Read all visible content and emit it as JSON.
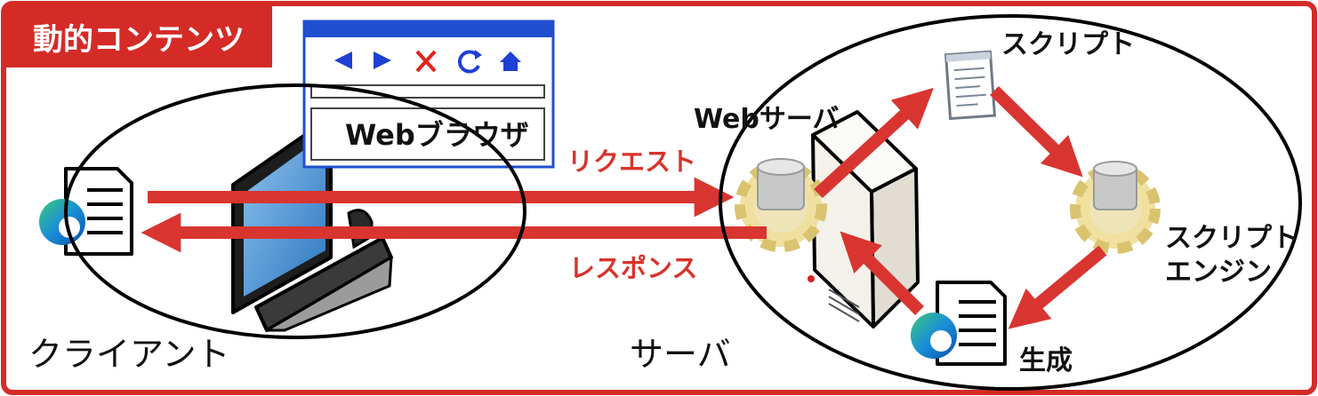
{
  "title": "動的コンテンツ",
  "browser": {
    "label": "Webブラウザ"
  },
  "arrows": {
    "request": "リクエスト",
    "response": "レスポンス"
  },
  "server": {
    "web_server": "Webサーバ",
    "script": "スクリプト",
    "engine_line1": "スクリプト",
    "engine_line2": "エンジン",
    "generated": "生成"
  },
  "regions": {
    "client": "クライアント",
    "server": "サーバ"
  },
  "colors": {
    "accent": "#d42b27",
    "arrow": "#d93530",
    "browser_bar": "#1f4fd0",
    "browser_icon": "#1f3fd6"
  },
  "icons": [
    "edge-document-icon",
    "computer-monitor-icon",
    "browser-window-icon",
    "server-tower-icon",
    "gear-icon",
    "script-document-icon"
  ]
}
